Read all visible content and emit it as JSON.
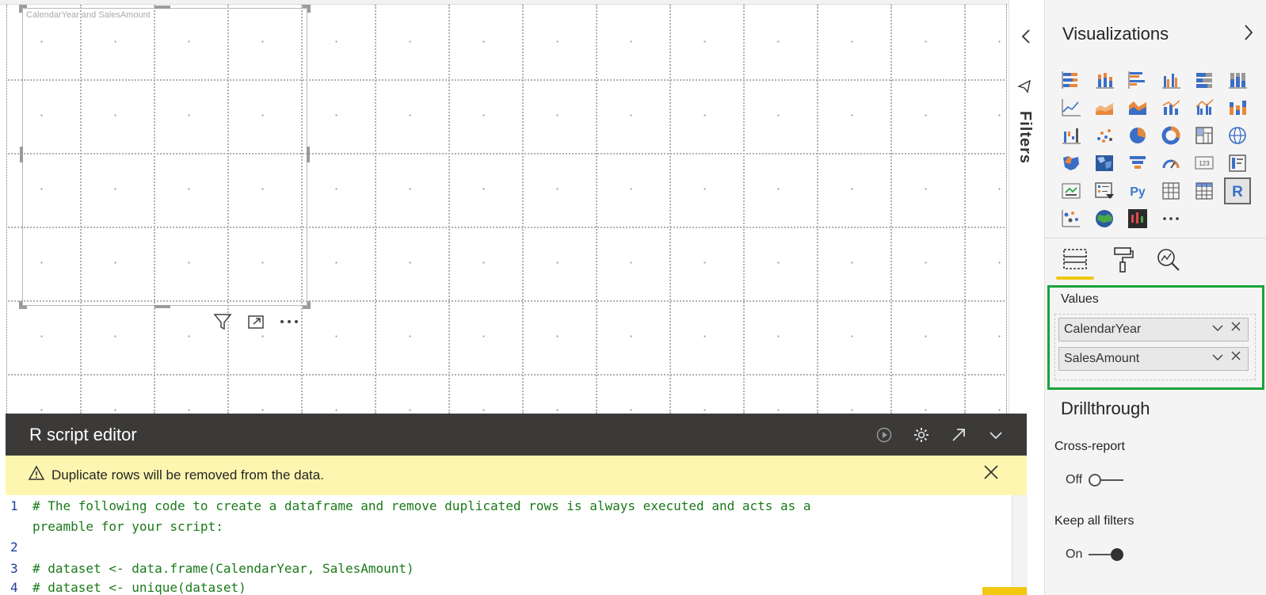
{
  "canvas": {
    "visual_title": "CalendarYear and SalesAmount"
  },
  "filters": {
    "label": "Filters",
    "collapse_icon": "chevron-left-icon",
    "filter_icon": "funnel-icon"
  },
  "visualizations": {
    "title": "Visualizations",
    "expand_icon": "chevron-right-icon",
    "icons": [
      "stacked-bar-chart",
      "stacked-column-chart",
      "clustered-bar-chart",
      "clustered-column-chart",
      "100-stacked-bar-chart",
      "100-stacked-column-chart",
      "line-chart",
      "area-chart",
      "stacked-area-chart",
      "line-and-stacked-column-chart",
      "line-and-clustered-column-chart",
      "ribbon-chart",
      "waterfall-chart",
      "scatter-chart",
      "pie-chart",
      "donut-chart",
      "treemap",
      "map",
      "filled-map",
      "shape-map",
      "funnel",
      "gauge",
      "card",
      "multi-row-card",
      "kpi",
      "slicer",
      "python-visual",
      "table",
      "matrix",
      "r-script-visual",
      "key-influencers",
      "arcgis-map",
      "custom-visual",
      "more-visuals"
    ],
    "tabs": [
      "fields",
      "format",
      "analytics"
    ]
  },
  "values_section": {
    "label": "Values",
    "fields": [
      {
        "name": "CalendarYear"
      },
      {
        "name": "SalesAmount"
      }
    ]
  },
  "drillthrough": {
    "title": "Drillthrough",
    "cross_report_label": "Cross-report",
    "cross_report_state": "Off",
    "keep_filters_label": "Keep all filters",
    "keep_filters_state": "On"
  },
  "r_editor": {
    "title": "R script editor",
    "warning": "Duplicate rows will be removed from the data.",
    "code_lines": [
      {
        "num": "1",
        "text": "# The following code to create a dataframe and remove duplicated rows is always executed and acts as a"
      },
      {
        "num": "",
        "text": "preamble for your script:"
      },
      {
        "num": "2",
        "text": ""
      },
      {
        "num": "3",
        "text": "# dataset <- data.frame(CalendarYear, SalesAmount)"
      },
      {
        "num": "4",
        "text": "# dataset <- unique(dataset)"
      }
    ]
  },
  "colors": {
    "accent_yellow": "#f2c811",
    "highlight_green": "#1aa339",
    "editor_header": "#3b3a39",
    "warning_bg": "#fdf6b0",
    "code_comment": "#1a7a1a"
  }
}
